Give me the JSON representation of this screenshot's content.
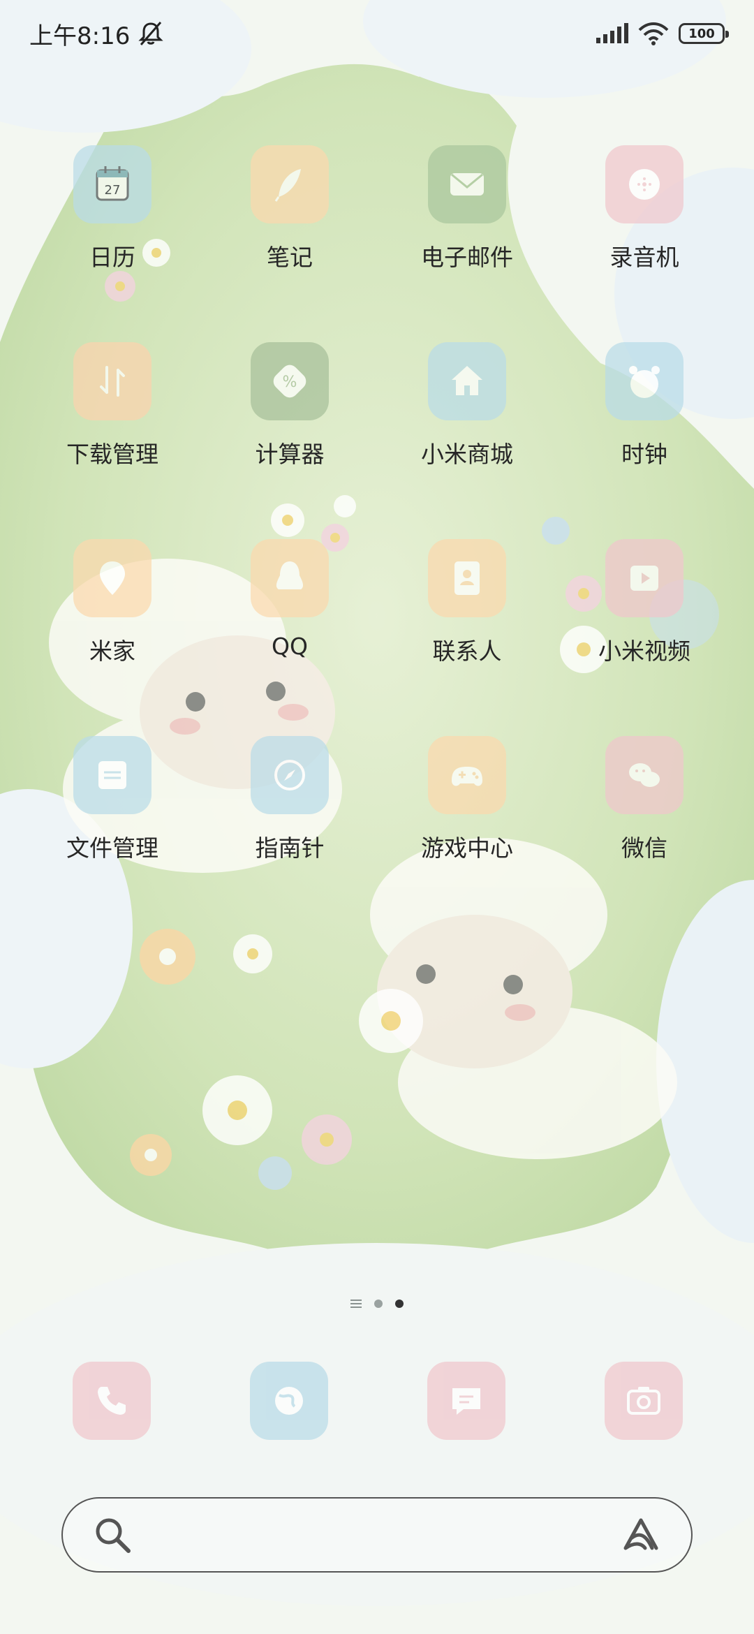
{
  "status_bar": {
    "time": "上午8:16",
    "battery": "100"
  },
  "apps": [
    {
      "label": "日历",
      "icon": "calendar-icon",
      "color": "#b9dbe8",
      "badge": "27"
    },
    {
      "label": "笔记",
      "icon": "feather-icon",
      "color": "#fbd9ad"
    },
    {
      "label": "电子邮件",
      "icon": "mail-icon",
      "color": "#aac79d"
    },
    {
      "label": "录音机",
      "icon": "recorder-icon",
      "color": "#f0c6cc"
    },
    {
      "label": "下载管理",
      "icon": "download-icon",
      "color": "#fbd3ad"
    },
    {
      "label": "计算器",
      "icon": "calculator-icon",
      "color": "#a7bf9a"
    },
    {
      "label": "小米商城",
      "icon": "home-icon",
      "color": "#b9dbe8"
    },
    {
      "label": "时钟",
      "icon": "alarm-clock-icon",
      "color": "#b9dbe8"
    },
    {
      "label": "米家",
      "icon": "location-pin-icon",
      "color": "#fbd9ad"
    },
    {
      "label": "QQ",
      "icon": "penguin-icon",
      "color": "#fbd9ad"
    },
    {
      "label": "联系人",
      "icon": "contact-card-icon",
      "color": "#fbd9ad"
    },
    {
      "label": "小米视频",
      "icon": "play-icon",
      "color": "#f0c6cc"
    },
    {
      "label": "文件管理",
      "icon": "folder-icon",
      "color": "#b9dbe8"
    },
    {
      "label": "指南针",
      "icon": "compass-icon",
      "color": "#b9dbe8"
    },
    {
      "label": "游戏中心",
      "icon": "gamepad-icon",
      "color": "#fbd9ad"
    },
    {
      "label": "微信",
      "icon": "wechat-icon",
      "color": "#f0c6cc"
    }
  ],
  "dock": [
    {
      "name": "phone",
      "icon": "phone-icon",
      "color": "#f0c6cc"
    },
    {
      "name": "browser",
      "icon": "globe-icon",
      "color": "#b9dbe8"
    },
    {
      "name": "messages",
      "icon": "message-icon",
      "color": "#f0c6cc"
    },
    {
      "name": "camera",
      "icon": "camera-icon",
      "color": "#f0c6cc"
    }
  ],
  "page_indicator": {
    "pages": 2,
    "current": 2
  },
  "search": {
    "placeholder": ""
  }
}
